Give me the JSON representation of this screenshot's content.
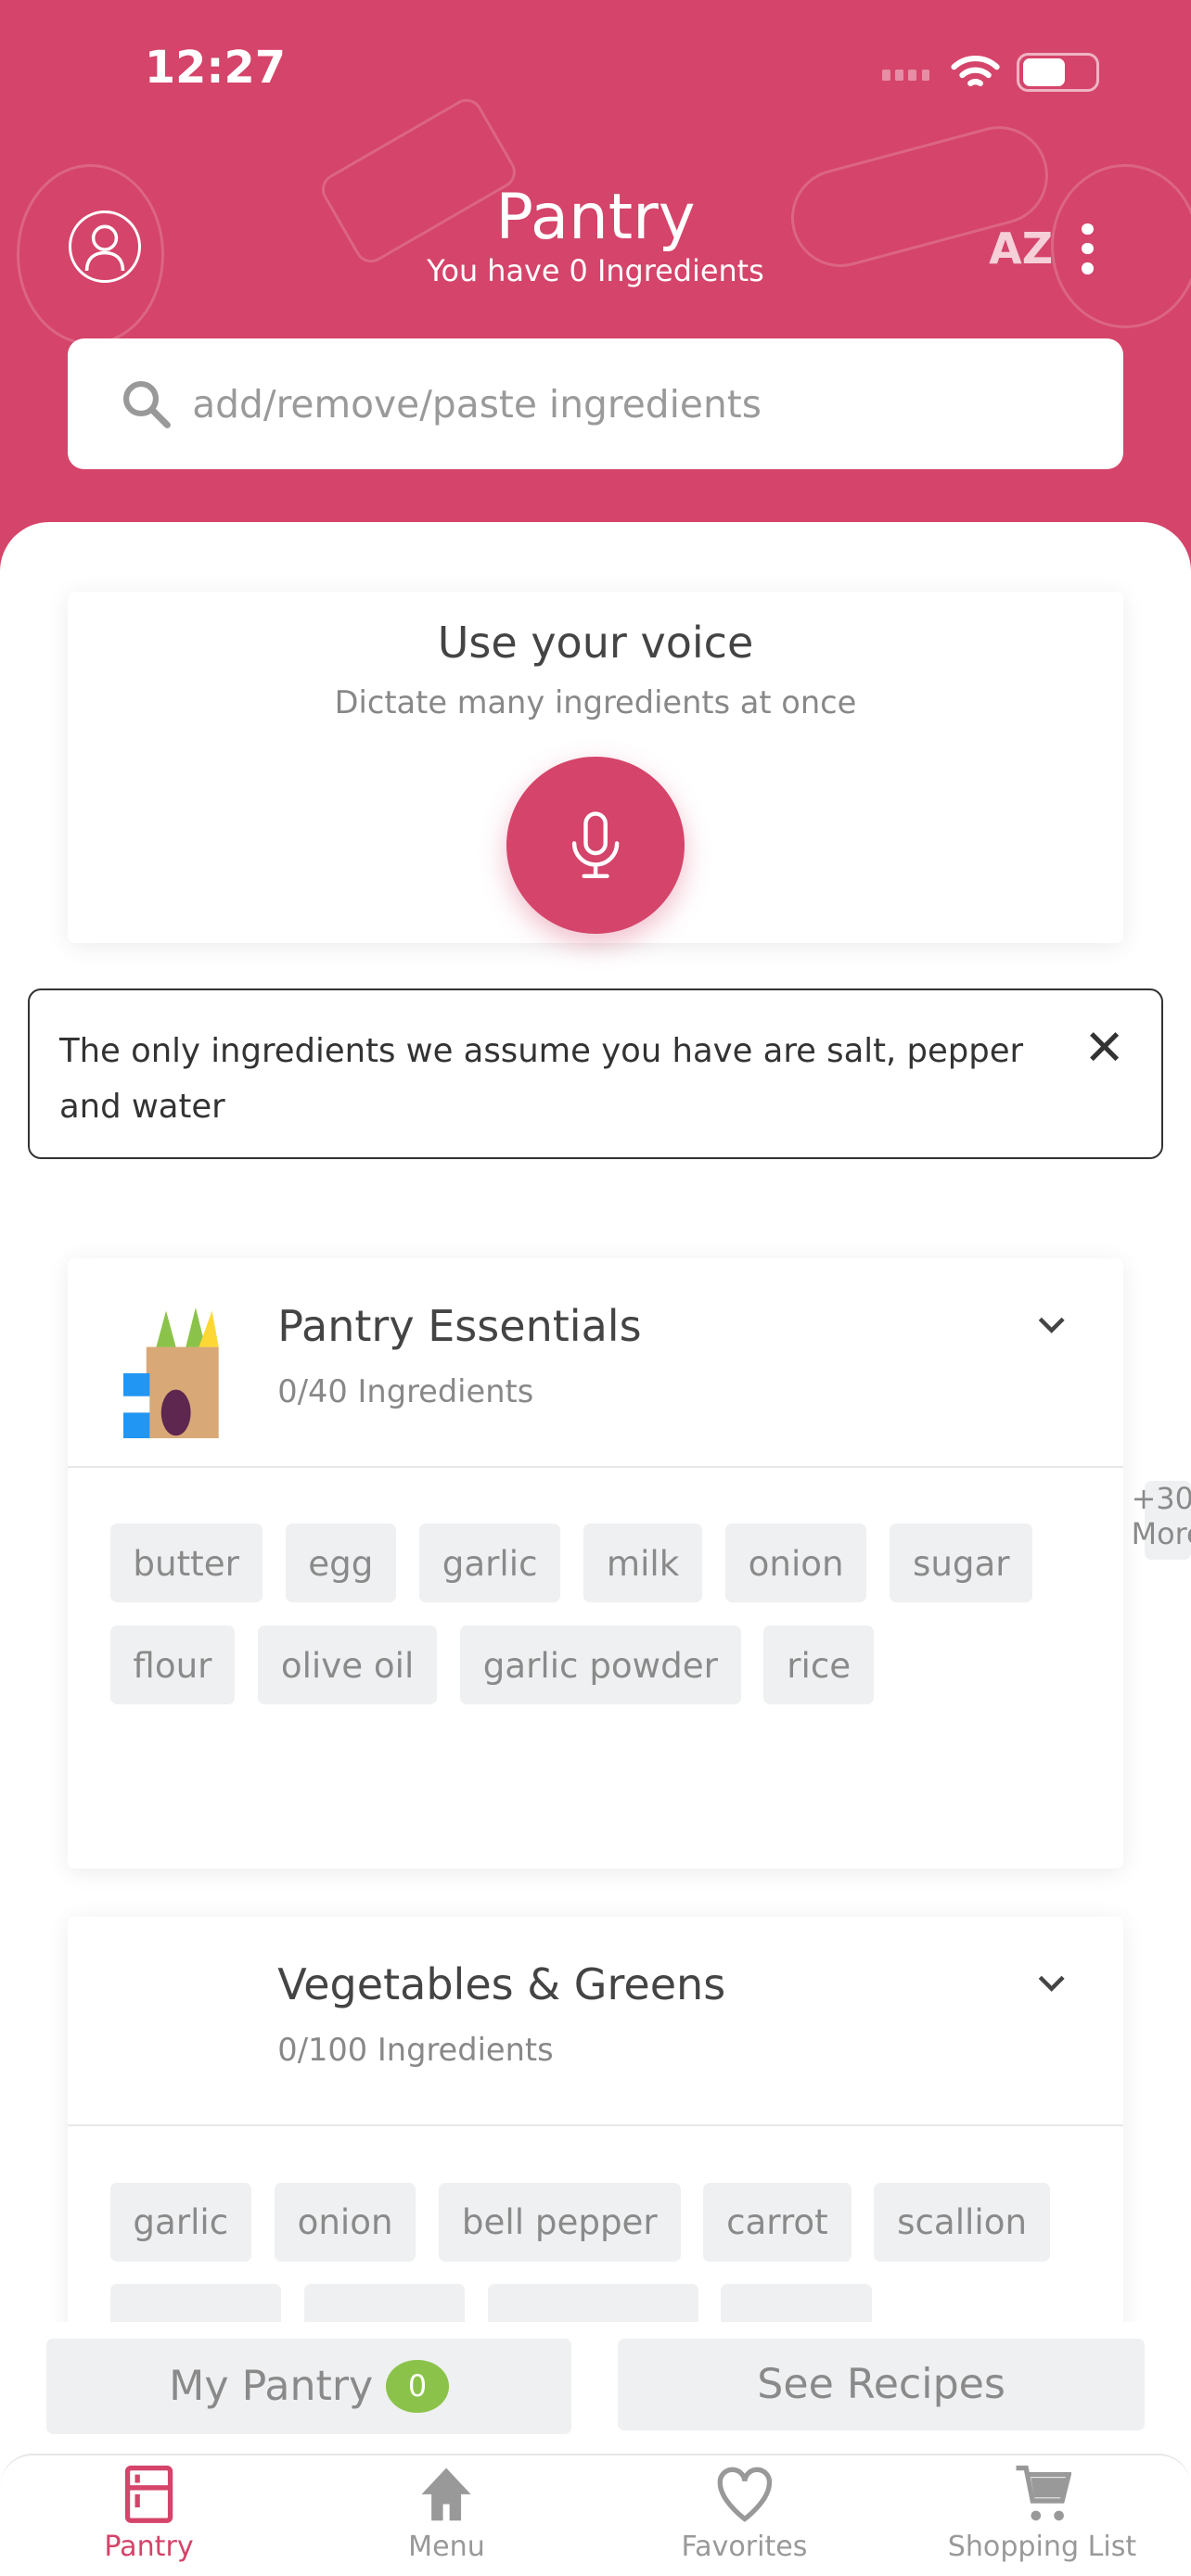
{
  "status_bar": {
    "time": "12:27"
  },
  "header": {
    "title": "Pantry",
    "subtitle": "You have 0 Ingredients",
    "sort_label": "AZ",
    "icons": [
      "user-icon",
      "sort-az-icon",
      "more-vertical-icon"
    ]
  },
  "search": {
    "placeholder": "add/remove/paste ingredients"
  },
  "voice": {
    "title": "Use your voice",
    "subtitle": "Dictate many ingredients at once"
  },
  "notice": {
    "text": "The only ingredients we assume you have are salt, pepper and water"
  },
  "categories": [
    {
      "title": "Pantry Essentials",
      "count": "0/40 Ingredients",
      "chips": [
        "butter",
        "egg",
        "garlic",
        "milk",
        "onion",
        "sugar",
        "flour",
        "olive oil",
        "garlic powder",
        "rice"
      ],
      "more": "+30 More"
    },
    {
      "title": "Vegetables & Greens",
      "count": "0/100 Ingredients",
      "chips": [
        "garlic",
        "onion",
        "bell pepper",
        "carrot",
        "scallion"
      ]
    }
  ],
  "actions": {
    "my_pantry": "My Pantry",
    "my_pantry_count": "0",
    "see_recipes": "See Recipes"
  },
  "tabs": [
    {
      "label": "Pantry",
      "active": true
    },
    {
      "label": "Menu"
    },
    {
      "label": "Favorites"
    },
    {
      "label": "Shopping List"
    }
  ],
  "colors": {
    "brand": "#d5446a",
    "badge": "#8bc34a",
    "chip_bg": "#eff0f1"
  }
}
